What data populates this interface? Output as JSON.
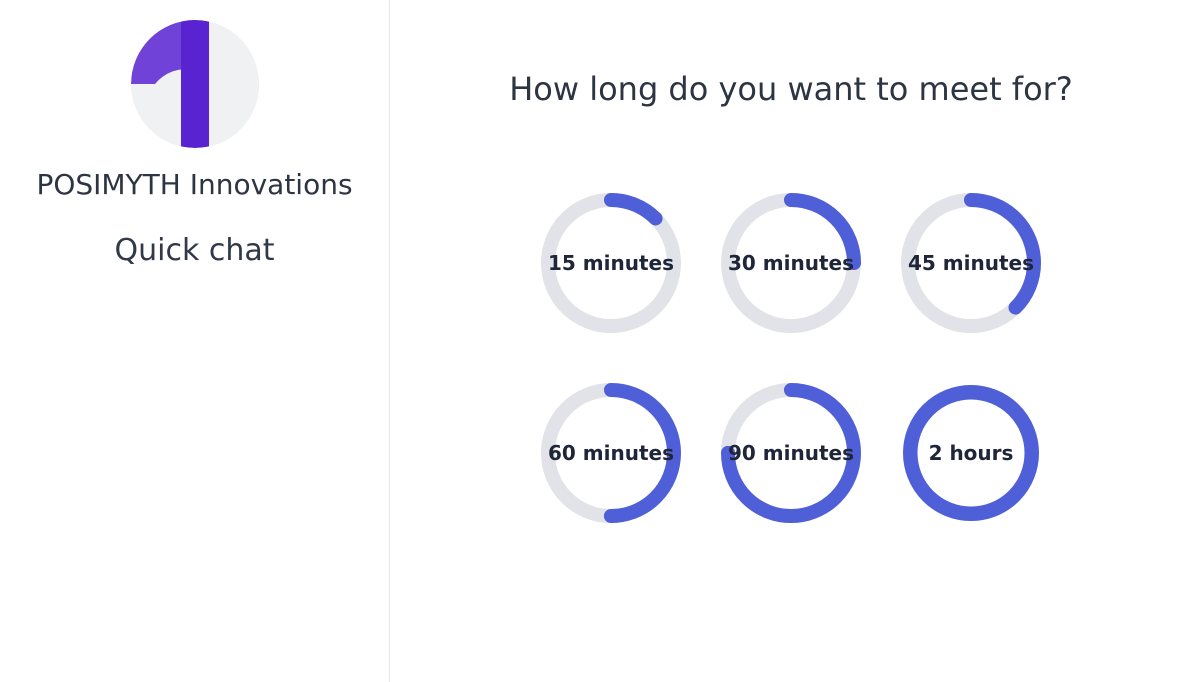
{
  "sidebar": {
    "brand_name": "POSIMYTH Innovations",
    "subtitle": "Quick chat"
  },
  "main": {
    "heading": "How long do you want to meet for?"
  },
  "colors": {
    "accent": "#4e5fd7",
    "track": "#e1e3e8",
    "text": "#2d3442",
    "logo_purple": "#5a23d1",
    "logo_teal": "#5fc2aa"
  },
  "durations": [
    {
      "label": "15 minutes",
      "fraction": 0.125,
      "double_ring": false
    },
    {
      "label": "30 minutes",
      "fraction": 0.25,
      "double_ring": false
    },
    {
      "label": "45 minutes",
      "fraction": 0.375,
      "double_ring": false
    },
    {
      "label": "60 minutes",
      "fraction": 0.5,
      "double_ring": false
    },
    {
      "label": "90 minutes",
      "fraction": 0.75,
      "double_ring": false
    },
    {
      "label": "2 hours",
      "fraction": 1.0,
      "double_ring": true
    }
  ]
}
